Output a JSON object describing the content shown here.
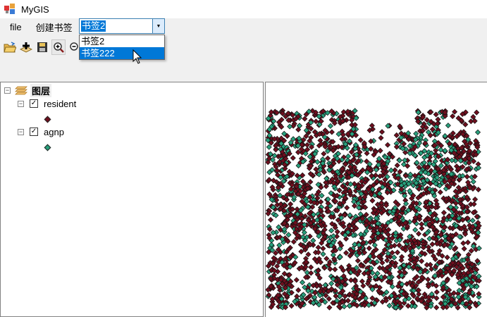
{
  "window": {
    "title": "MyGIS"
  },
  "menu": {
    "items": [
      {
        "label": "file"
      },
      {
        "label": "创建书签"
      }
    ]
  },
  "bookmark_combo": {
    "value": "书签2",
    "options": [
      "书签2",
      "书签222"
    ],
    "highlighted": "书签222"
  },
  "toolbar": {
    "icons": [
      "open-folder-icon",
      "add-data-icon",
      "save-icon",
      "zoom-in-icon",
      "zoom-out-icon"
    ]
  },
  "toc": {
    "root": "图层",
    "layers": [
      {
        "name": "resident",
        "checked": true,
        "color": "#6e0f1e"
      },
      {
        "name": "agnp",
        "checked": true,
        "color": "#28a07c"
      }
    ]
  },
  "colors": {
    "resident": "#6e0f1e",
    "agnp": "#28a07c",
    "selection": "#0078d7"
  }
}
